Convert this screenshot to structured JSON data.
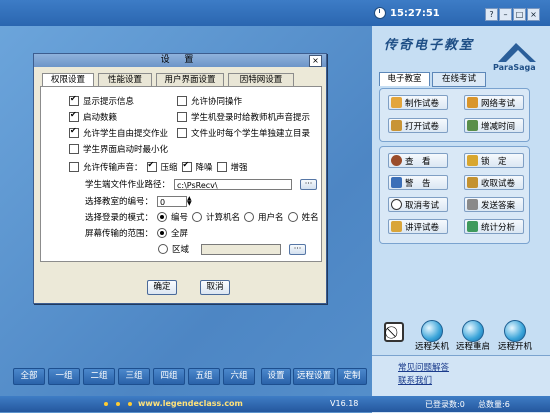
{
  "topbar": {
    "time": "15:27:51",
    "win_help": "?",
    "win_min": "–",
    "win_restore": "□",
    "win_close": "×"
  },
  "brand": {
    "title": "传奇电子教室",
    "logo_text": "ParaSaga"
  },
  "right_tabs": [
    "电子教室",
    "在线考试"
  ],
  "exam_buttons": [
    "制作试卷",
    "网络考试",
    "打开试卷",
    "增减时间"
  ],
  "control_buttons": [
    "查　看",
    "锁　定",
    "警　告",
    "收取试卷",
    "取消考试",
    "发送答案",
    "讲评试卷",
    "统计分析"
  ],
  "remote": [
    "远程关机",
    "远程重启",
    "远程开机"
  ],
  "help_links": [
    "常见问题解答",
    "联系我们"
  ],
  "groups": [
    "全部",
    "一组",
    "二组",
    "三组",
    "四组",
    "五组",
    "六组"
  ],
  "group_actions": [
    "设置",
    "远程设置",
    "定制"
  ],
  "footer": {
    "site": "www.legendeclass.com",
    "version": "V16.18",
    "logged": "已登录数:0",
    "total": "总数量:6"
  },
  "dialog": {
    "title": "设 置",
    "close": "×",
    "tabs": [
      "权限设置",
      "性能设置",
      "用户界面设置",
      "因特网设置"
    ],
    "options": [
      {
        "label": "显示提示信息",
        "checked": true
      },
      {
        "label": "允许协同操作",
        "checked": false
      },
      {
        "label": "启动数籁",
        "checked": true
      },
      {
        "label": "学生机登录时给教师机声音提示",
        "checked": false
      },
      {
        "label": "允许学生自由提交作业",
        "checked": true
      },
      {
        "label": "文件业时每个学生单独建立目录",
        "checked": false
      },
      {
        "label": "学生界面启动时最小化",
        "checked": false
      }
    ],
    "sound": {
      "label": "允许传输声音：",
      "checked": false,
      "opts": [
        {
          "label": "压缩",
          "checked": true
        },
        {
          "label": "降噪",
          "checked": true
        },
        {
          "label": "增强",
          "checked": false
        }
      ]
    },
    "path_label": "学生端文件作业路径：",
    "path_value": "c:\\PsRecv\\",
    "browse": "···",
    "room_label": "选择教室的编号：",
    "room_value": "0",
    "login_label": "选择登录的模式：",
    "login_modes": [
      {
        "label": "编号",
        "checked": true
      },
      {
        "label": "计算机名",
        "checked": false
      },
      {
        "label": "用户名",
        "checked": false
      },
      {
        "label": "姓名",
        "checked": false
      }
    ],
    "screen_label": "屏幕传输的范围：",
    "screen_full": "全屏",
    "screen_area": "区域",
    "ok": "确定",
    "cancel": "取消"
  }
}
